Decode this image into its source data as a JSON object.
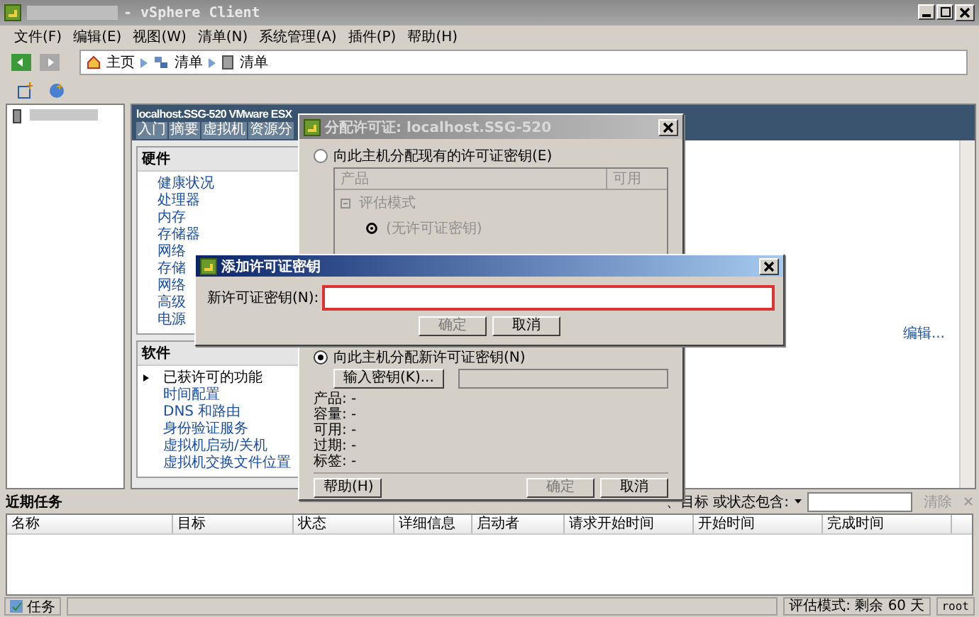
{
  "window": {
    "title": "- vSphere Client"
  },
  "menu": [
    "文件(F)",
    "编辑(E)",
    "视图(W)",
    "清单(N)",
    "系统管理(A)",
    "插件(P)",
    "帮助(H)"
  ],
  "breadcrumbs": [
    {
      "label": "主页",
      "kind": "home"
    },
    {
      "label": "清单",
      "kind": "inventory"
    },
    {
      "label": "清单",
      "kind": "host"
    }
  ],
  "host": {
    "title": "localhost.SSG-520 VMware ESX",
    "tabs": [
      {
        "label": "入门",
        "selected": false
      },
      {
        "label": "摘要",
        "selected": false
      },
      {
        "label": "虚拟机",
        "selected": false
      },
      {
        "label": "资源分",
        "selected": false
      }
    ]
  },
  "hardware": {
    "title": "硬件",
    "items": [
      "健康状况",
      "处理器",
      "内存",
      "存储器",
      "网络",
      "存储",
      "网络",
      "高级",
      "电源"
    ]
  },
  "software": {
    "title": "软件",
    "items": [
      {
        "label": "已获许可的功能",
        "selected": true
      },
      {
        "label": "时间配置",
        "selected": false
      },
      {
        "label": "DNS 和路由",
        "selected": false
      },
      {
        "label": "身份验证服务",
        "selected": false
      },
      {
        "label": "虚拟机启动/关机",
        "selected": false
      },
      {
        "label": "虚拟机交换文件位置",
        "selected": false
      }
    ]
  },
  "edit_link": "编辑...",
  "tasks": {
    "title": "近期任务",
    "filter_label": "、目标 或状态包含:",
    "clear": "清除",
    "columns": [
      "名称",
      "目标",
      "状态",
      "详细信息",
      "启动者",
      "请求开始时间",
      "开始时间",
      "完成时间"
    ]
  },
  "status_bar": {
    "tasks_button": "任务",
    "evaluation": "评估模式: 剩余 60 天",
    "user": "root"
  },
  "license_dialog": {
    "title": "分配许可证: localhost.SSG-520",
    "options": [
      {
        "label": "向此主机分配现有的许可证密钥(E)",
        "selected": false
      },
      {
        "label": "向此主机分配新许可证密钥(N)",
        "selected": true
      }
    ],
    "list_columns": [
      "产品",
      "可用"
    ],
    "tree": [
      {
        "label": "评估模式",
        "expanded": true,
        "children": [
          {
            "label": "(无许可证密钥)"
          }
        ]
      }
    ],
    "enter_key_button": "输入密钥(K)...",
    "details": [
      "产品: -",
      "容量: -",
      "可用: -",
      "过期: -",
      "标签: -"
    ],
    "buttons": [
      {
        "label": "帮助(H)",
        "disabled": false
      },
      {
        "label": "确定",
        "disabled": true
      },
      {
        "label": "取消",
        "disabled": false
      }
    ]
  },
  "key_dialog": {
    "title": "添加许可证密钥",
    "field_label": "新许可证密钥(N):",
    "buttons": [
      {
        "label": "确定",
        "disabled": true
      },
      {
        "label": "取消",
        "disabled": false
      }
    ]
  }
}
